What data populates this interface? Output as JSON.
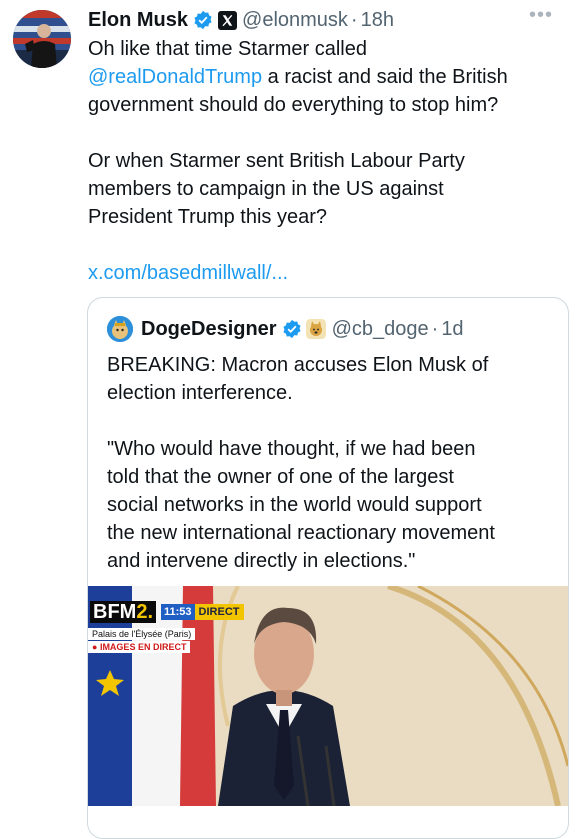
{
  "author": {
    "name": "Elon Musk",
    "handle": "@elonmusk",
    "separator": "·",
    "time": "18h",
    "verified_icon": "verified-badge-icon",
    "affiliation_icon": "x-logo-icon",
    "more_icon": "more-dots-icon"
  },
  "tweet": {
    "lines": [
      "Oh like that time Starmer called",
      "@realDonaldTrump",
      " a racist and said the British",
      "government should do everything to stop him?",
      "",
      "Or when Starmer sent British Labour Party",
      "members to campaign in the US against",
      "President Trump this year?",
      "",
      "x.com/basedmillwall/..."
    ]
  },
  "quote": {
    "name": "DogeDesigner",
    "handle": "@cb_doge",
    "separator": "·",
    "time": "1d",
    "lines": [
      "BREAKING: Macron accuses Elon Musk of",
      "election interference.",
      "",
      "\"Who would have thought, if we had been",
      "told that the owner of one of the largest",
      "social networks in the world would support",
      "the new international reactionary movement",
      "and intervene directly in elections.\""
    ]
  },
  "media": {
    "channel": "BFM",
    "channel_number": "2.",
    "clock": "11:53",
    "status": "DIRECT",
    "location": "Palais de l'Élysée (Paris)",
    "live_label": "IMAGES EN DIRECT"
  },
  "colors": {
    "link": "#1d9bf0",
    "text": "#0f1419",
    "secondary": "#536471",
    "border": "#cfd9de"
  }
}
